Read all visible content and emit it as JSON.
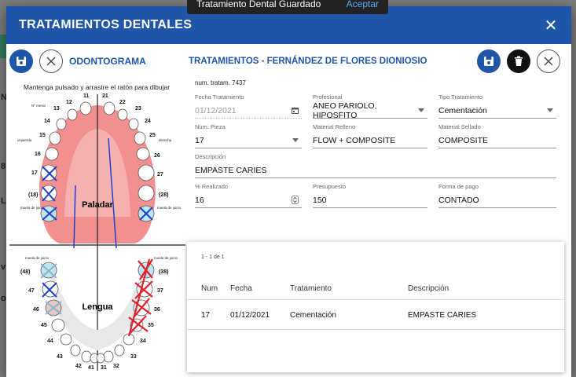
{
  "background": {
    "letters": [
      "N",
      "8",
      "L",
      "v",
      "o"
    ]
  },
  "snackbar": {
    "message": "Tratamiento Dental Guardado",
    "action": "Aceptar"
  },
  "dialog": {
    "title": "TRATAMIENTOS DENTALES",
    "close_glyph": "✕"
  },
  "odontogram": {
    "label": "ODONTOGRAMA",
    "hint": "Mantenga pulsado y arrastre el ratón para dibujar",
    "upper_label": "Paladar",
    "lower_label": "Lengua",
    "small_labels": {
      "n_mesio": "Nº mesio",
      "izquierda": "izquierda",
      "derecha": "derecha",
      "muela_juicio": "muela de juicio"
    },
    "upper_teeth": [
      "11",
      "12",
      "13",
      "14",
      "15",
      "16",
      "17",
      "(18)",
      "21",
      "22",
      "23",
      "24",
      "25",
      "26",
      "27",
      "(28)"
    ],
    "lower_teeth": [
      "(48)",
      "47",
      "46",
      "45",
      "44",
      "43",
      "42",
      "41",
      "31",
      "32",
      "33",
      "34",
      "35",
      "36",
      "37",
      "(38)"
    ]
  },
  "panel": {
    "title": "TRATAMIENTOS - FERNÁNDEZ DE FLORES DIONIOSIO",
    "num_tratam_label": "num. tratam.",
    "num_tratam": "7437"
  },
  "form": {
    "fecha_label": "Fecha Tratamiento",
    "fecha": "01/12/2021",
    "profesional_label": "Profesional",
    "profesional": "ANEO PARIOLO, HIPOSFITO",
    "tipo_label": "Tipo Tratamiento",
    "tipo": "Cementación",
    "pieza_label": "Num. Pieza",
    "pieza": "17",
    "relleno_label": "Material Relleno",
    "relleno": "FLOW + COMPOSITE",
    "sellado_label": "Material Sellado",
    "sellado": "COMPOSITE",
    "descripcion_label": "Descripción",
    "descripcion": "EMPASTE CARIES",
    "realizado_label": "% Realizado",
    "realizado": "16",
    "presupuesto_label": "Presupuesto",
    "presupuesto": "150",
    "pago_label": "Forma de pago",
    "pago": "CONTADO"
  },
  "table": {
    "range": "1 - 1 de 1",
    "headers": [
      "Num",
      "Fecha",
      "Tratamiento",
      "Descripción"
    ],
    "rows": [
      [
        "17",
        "01/12/2021",
        "Cementación",
        "EMPASTE CARIES"
      ]
    ]
  },
  "colors": {
    "primary": "#1f56a8",
    "marks_blue": "#1e3fd0",
    "marks_red": "#e0202a"
  }
}
